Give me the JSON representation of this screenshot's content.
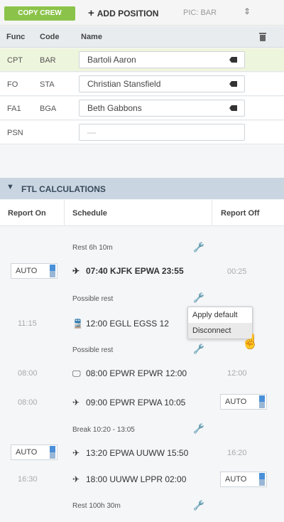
{
  "toolbar": {
    "copy_crew": "COPY CREW",
    "add_position": "ADD POSITION",
    "pic": "PIC: BAR"
  },
  "crew_table": {
    "headers": {
      "func": "Func",
      "code": "Code",
      "name": "Name"
    },
    "rows": [
      {
        "func": "CPT",
        "code": "BAR",
        "name": "Bartoli Aaron"
      },
      {
        "func": "FO",
        "code": "STA",
        "name": "Christian Stansfield"
      },
      {
        "func": "FA1",
        "code": "BGA",
        "name": "Beth Gabbons"
      },
      {
        "func": "PSN",
        "code": "",
        "name": "—"
      }
    ]
  },
  "ftl": {
    "title": "FTL CALCULATIONS",
    "headers": {
      "report_on": "Report On",
      "schedule": "Schedule",
      "report_off": "Report Off"
    },
    "rows": {
      "rest1": "Rest 6h 10m",
      "leg1": {
        "report_on": "AUTO",
        "text": "07:40 KJFK EPWA 23:55",
        "report_off": "00:25"
      },
      "rest2": "Possible rest",
      "leg2": {
        "report_on": "11:15",
        "text": "12:00 EGLL EGSS 12"
      },
      "rest3": "Possible rest",
      "leg3": {
        "report_on": "08:00",
        "text": "08:00 EPWR EPWR 12:00",
        "report_off": "12:00"
      },
      "leg4": {
        "report_on": "08:00",
        "text": "09:00 EPWR EPWA 10:05",
        "report_off": "AUTO"
      },
      "rest4": "Break 10:20 - 13:05",
      "leg5": {
        "report_on": "AUTO",
        "text": "13:20 EPWA UUWW 15:50",
        "report_off": "16:20"
      },
      "leg6": {
        "report_on": "16:30",
        "text": "18:00 UUWW LPPR 02:00",
        "report_off": "AUTO"
      },
      "rest5": "Rest 100h 30m"
    }
  },
  "context_menu": {
    "items": [
      "Apply default",
      "Disconnect"
    ]
  },
  "icons": {
    "plane": "plane-icon",
    "train": "train-icon",
    "monitor": "monitor-icon",
    "wrench": "wrench-icon",
    "delete": "delete-tag-icon",
    "trash": "trash-icon"
  }
}
